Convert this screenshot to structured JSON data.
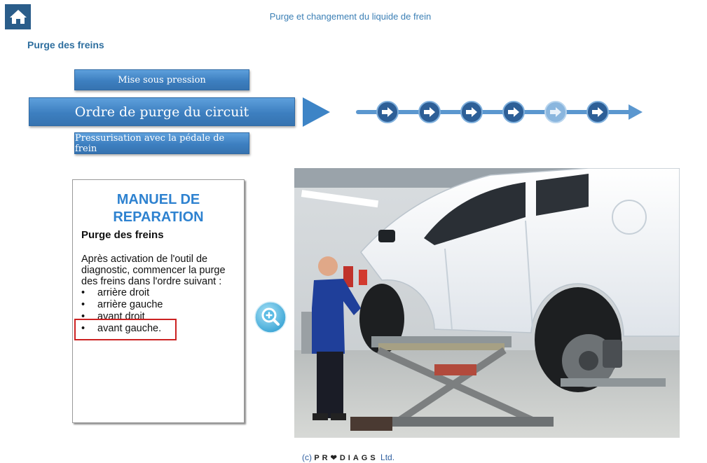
{
  "header": {
    "title": "Purge et changement  du liquide de frein",
    "section_title": "Purge des freins",
    "home_icon": "home-icon"
  },
  "steps": {
    "buttons": [
      {
        "label": "Mise sous pression"
      },
      {
        "label": "Ordre de purge du circuit"
      },
      {
        "label": "Pressurisation avec la pédale de frein"
      }
    ],
    "progress_step_count": 6,
    "progress_current_step": 5
  },
  "manual": {
    "heading_line1": "MANUEL DE",
    "heading_line2": "REPARATION",
    "subtitle": "Purge des freins",
    "text": "Après activation de l'outil de diagnostic, commencer la purge des freins dans l'ordre suivant :",
    "bullets": [
      "arrière droit",
      "arrière gauche",
      "avant droit",
      "avant gauche."
    ]
  },
  "zoom": {
    "icon": "zoom-in-icon"
  },
  "footer": {
    "prefix": "(c)",
    "brand": "PR❤DIAGS",
    "suffix": "Ltd."
  },
  "colors": {
    "accent": "#3d7fc0",
    "title": "#3b7fb5",
    "heading": "#2e82d0",
    "highlight": "#cc2222"
  }
}
